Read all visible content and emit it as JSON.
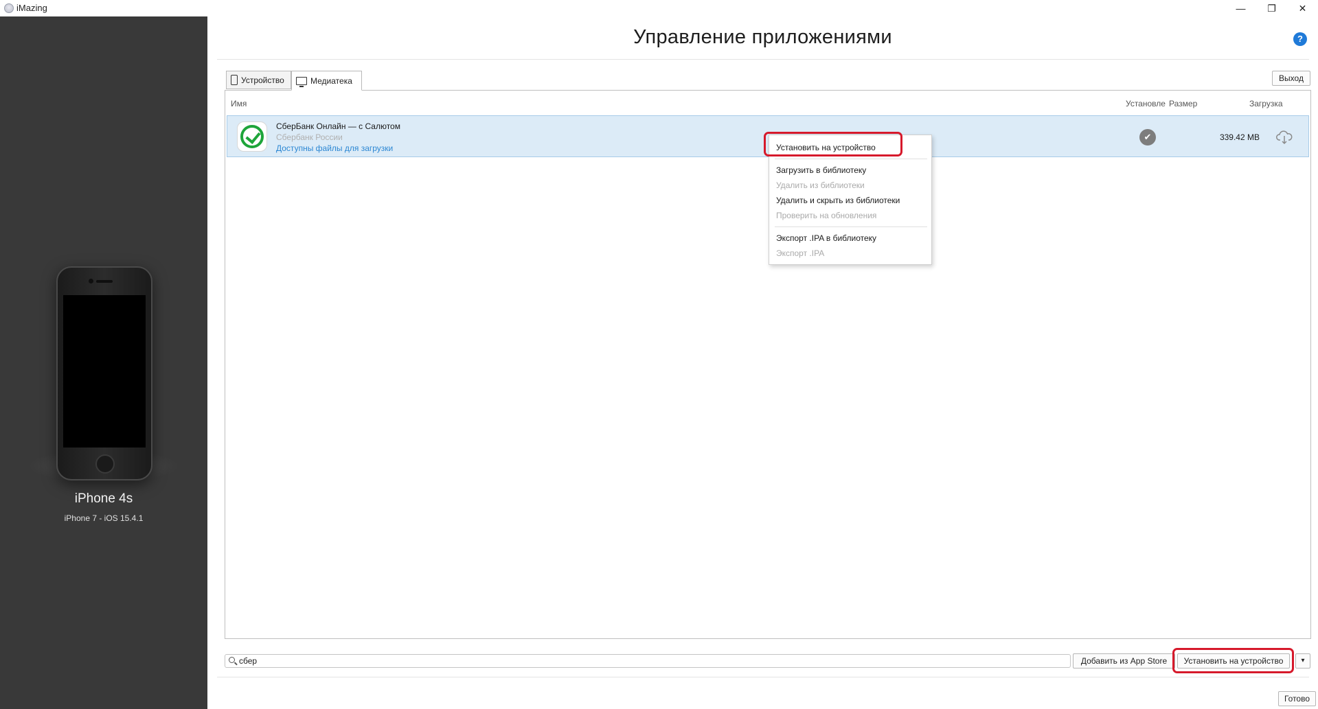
{
  "window": {
    "app_title": "iMazing",
    "minimize": "—",
    "maximize": "❐",
    "close": "✕"
  },
  "device": {
    "name": "iPhone 4s",
    "model": "iPhone 7 - iOS 15.4.1"
  },
  "page_title": "Управление приложениями",
  "help": "?",
  "tabs": [
    {
      "label": "Устройство",
      "active": false
    },
    {
      "label": "Медиатека",
      "active": true
    }
  ],
  "exit_label": "Выход",
  "columns": {
    "name": "Имя",
    "installed": "Установле",
    "size": "Размер",
    "download": "Загрузка"
  },
  "apps": [
    {
      "name": "СберБанк Онлайн — с Салютом",
      "vendor": "Сбербанк России",
      "status_link": "Доступны файлы для загрузки",
      "installed": true,
      "size": "339.42 MB"
    }
  ],
  "context_menu": {
    "items": [
      {
        "label": "Установить на устройство",
        "enabled": true
      },
      {
        "label": "Загрузить в библиотеку",
        "enabled": true
      },
      {
        "label": "Удалить из библиотеки",
        "enabled": false
      },
      {
        "label": "Удалить и скрыть из библиотеки",
        "enabled": true
      },
      {
        "label": "Проверить на обновления",
        "enabled": false
      },
      {
        "label": "Экспорт .IPA в библиотеку",
        "enabled": true
      },
      {
        "label": "Экспорт .IPA",
        "enabled": false
      }
    ]
  },
  "search": {
    "value": "сбер"
  },
  "buttons": {
    "add_from_app_store": "Добавить из App Store",
    "install_to_device": "Установить на устройство",
    "dropdown": "▾",
    "done": "Готово"
  },
  "colors": {
    "sidebar": "#393939",
    "selection": "#dcebf7",
    "highlight": "#d6192b",
    "link": "#2c87d3",
    "brand_green": "#1ea53a"
  }
}
